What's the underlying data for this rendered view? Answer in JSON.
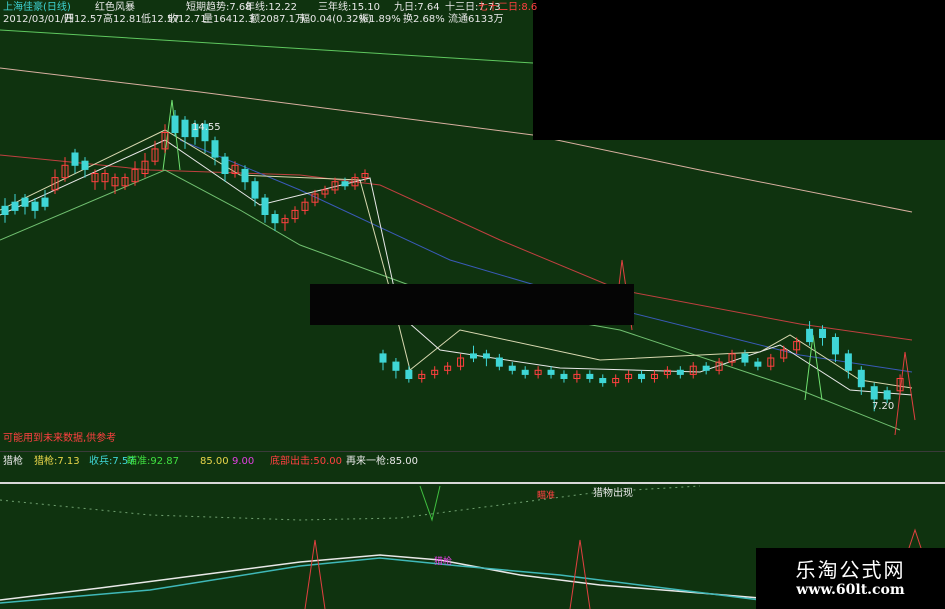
{
  "header": {
    "stock_name": "上海佳豪(日线)",
    "indicator_name": "红色风暴",
    "short_trend": "短期趋势:7.68",
    "year_line": "年线:12.22",
    "three_year_line": "三年线:15.10",
    "nine_day": "九日:7.64",
    "thirteen_day": "十三日:7.73",
    "seventy_two": "七十二日:8.6"
  },
  "ohlc_row": {
    "date": "2012/03/01/四",
    "open": "开12.57",
    "high": "高12.81",
    "low": "低12.57",
    "close": "收12.71",
    "volume": "量16412.3",
    "amount": "额2087.1万",
    "change": "幅0.04(0.32%)",
    "amplitude": "振1.89%",
    "turnover": "换2.68%",
    "float": "流通6133万"
  },
  "price_annotations": {
    "high_label": "14.55",
    "low_label": "7.20"
  },
  "disclaimer": "可能用到未来数据,供参考",
  "lower_panel": {
    "name": "猎枪",
    "hunt": "猎枪:7.13",
    "collect": "收兵:7.57",
    "aim": "瞄准:92.87",
    "value_85": "85.00",
    "value_9": "9.00",
    "bearish_out": "底部出击:50.00",
    "again": "再来一枪:85.00",
    "prey_appears": "猎物出现",
    "aim_marker": "瞄准",
    "hunt_marker": "猎枪"
  },
  "watermark": {
    "title": "乐淘公式网",
    "url": "www.60lt.com"
  },
  "chart_data": {
    "type": "candlestick",
    "main_price_range": [
      6.5,
      16.5
    ],
    "high_point": 14.55,
    "low_point": 7.2,
    "candles": [
      {
        "o": 12.0,
        "c": 12.2,
        "h": 12.4,
        "l": 11.8,
        "up": false
      },
      {
        "o": 12.1,
        "c": 12.3,
        "h": 12.5,
        "l": 12.0,
        "up": false
      },
      {
        "o": 12.2,
        "c": 12.4,
        "h": 12.5,
        "l": 12.0,
        "up": false
      },
      {
        "o": 12.3,
        "c": 12.1,
        "h": 12.4,
        "l": 11.9,
        "up": false
      },
      {
        "o": 12.2,
        "c": 12.4,
        "h": 12.6,
        "l": 12.1,
        "up": false
      },
      {
        "o": 12.6,
        "c": 12.9,
        "h": 13.1,
        "l": 12.5,
        "up": true
      },
      {
        "o": 12.9,
        "c": 13.2,
        "h": 13.4,
        "l": 12.8,
        "up": true
      },
      {
        "o": 13.2,
        "c": 13.5,
        "h": 13.6,
        "l": 13.0,
        "up": false
      },
      {
        "o": 13.3,
        "c": 13.1,
        "h": 13.4,
        "l": 12.9,
        "up": false
      },
      {
        "o": 13.0,
        "c": 12.8,
        "h": 13.1,
        "l": 12.6,
        "up": true
      },
      {
        "o": 12.8,
        "c": 13.0,
        "h": 13.1,
        "l": 12.6,
        "up": true
      },
      {
        "o": 12.9,
        "c": 12.7,
        "h": 13.0,
        "l": 12.5,
        "up": true
      },
      {
        "o": 12.7,
        "c": 12.9,
        "h": 13.0,
        "l": 12.6,
        "up": true
      },
      {
        "o": 12.8,
        "c": 13.1,
        "h": 13.3,
        "l": 12.7,
        "up": true
      },
      {
        "o": 13.0,
        "c": 13.3,
        "h": 13.5,
        "l": 12.9,
        "up": true
      },
      {
        "o": 13.3,
        "c": 13.6,
        "h": 13.8,
        "l": 13.2,
        "up": true
      },
      {
        "o": 13.6,
        "c": 14.0,
        "h": 14.2,
        "l": 13.5,
        "up": true
      },
      {
        "o": 14.0,
        "c": 14.4,
        "h": 14.55,
        "l": 13.9,
        "up": false
      },
      {
        "o": 14.3,
        "c": 13.9,
        "h": 14.4,
        "l": 13.6,
        "up": false
      },
      {
        "o": 13.9,
        "c": 14.2,
        "h": 14.3,
        "l": 13.7,
        "up": false
      },
      {
        "o": 14.2,
        "c": 13.8,
        "h": 14.3,
        "l": 13.5,
        "up": false
      },
      {
        "o": 13.8,
        "c": 13.4,
        "h": 13.9,
        "l": 13.2,
        "up": false
      },
      {
        "o": 13.4,
        "c": 13.0,
        "h": 13.5,
        "l": 12.8,
        "up": false
      },
      {
        "o": 13.0,
        "c": 13.2,
        "h": 13.3,
        "l": 12.9,
        "up": true
      },
      {
        "o": 13.1,
        "c": 12.8,
        "h": 13.2,
        "l": 12.6,
        "up": false
      },
      {
        "o": 12.8,
        "c": 12.4,
        "h": 12.9,
        "l": 12.2,
        "up": false
      },
      {
        "o": 12.4,
        "c": 12.0,
        "h": 12.5,
        "l": 11.8,
        "up": false
      },
      {
        "o": 12.0,
        "c": 11.8,
        "h": 12.1,
        "l": 11.6,
        "up": false
      },
      {
        "o": 11.8,
        "c": 11.9,
        "h": 12.0,
        "l": 11.6,
        "up": true
      },
      {
        "o": 11.9,
        "c": 12.1,
        "h": 12.2,
        "l": 11.8,
        "up": true
      },
      {
        "o": 12.1,
        "c": 12.3,
        "h": 12.4,
        "l": 12.0,
        "up": true
      },
      {
        "o": 12.3,
        "c": 12.5,
        "h": 12.6,
        "l": 12.2,
        "up": true
      },
      {
        "o": 12.5,
        "c": 12.6,
        "h": 12.7,
        "l": 12.4,
        "up": true
      },
      {
        "o": 12.6,
        "c": 12.8,
        "h": 12.9,
        "l": 12.5,
        "up": true
      },
      {
        "o": 12.8,
        "c": 12.7,
        "h": 12.9,
        "l": 12.6,
        "up": false
      },
      {
        "o": 12.7,
        "c": 12.9,
        "h": 13.0,
        "l": 12.6,
        "up": true
      },
      {
        "o": 12.9,
        "c": 13.0,
        "h": 13.1,
        "l": 12.8,
        "up": true
      },
      {
        "o": 8.6,
        "c": 8.4,
        "h": 8.7,
        "l": 8.2,
        "up": false
      },
      {
        "o": 8.4,
        "c": 8.2,
        "h": 8.5,
        "l": 8.0,
        "up": false
      },
      {
        "o": 8.2,
        "c": 8.0,
        "h": 8.3,
        "l": 7.9,
        "up": false
      },
      {
        "o": 8.0,
        "c": 8.1,
        "h": 8.2,
        "l": 7.9,
        "up": true
      },
      {
        "o": 8.1,
        "c": 8.2,
        "h": 8.3,
        "l": 8.0,
        "up": true
      },
      {
        "o": 8.2,
        "c": 8.3,
        "h": 8.4,
        "l": 8.1,
        "up": true
      },
      {
        "o": 8.3,
        "c": 8.5,
        "h": 8.6,
        "l": 8.2,
        "up": true
      },
      {
        "o": 8.5,
        "c": 8.6,
        "h": 8.8,
        "l": 8.4,
        "up": false
      },
      {
        "o": 8.6,
        "c": 8.5,
        "h": 8.7,
        "l": 8.3,
        "up": false
      },
      {
        "o": 8.5,
        "c": 8.3,
        "h": 8.6,
        "l": 8.2,
        "up": false
      },
      {
        "o": 8.3,
        "c": 8.2,
        "h": 8.4,
        "l": 8.1,
        "up": false
      },
      {
        "o": 8.2,
        "c": 8.1,
        "h": 8.3,
        "l": 8.0,
        "up": false
      },
      {
        "o": 8.1,
        "c": 8.2,
        "h": 8.3,
        "l": 8.0,
        "up": true
      },
      {
        "o": 8.2,
        "c": 8.1,
        "h": 8.3,
        "l": 8.0,
        "up": false
      },
      {
        "o": 8.1,
        "c": 8.0,
        "h": 8.2,
        "l": 7.9,
        "up": false
      },
      {
        "o": 8.0,
        "c": 8.1,
        "h": 8.2,
        "l": 7.9,
        "up": true
      },
      {
        "o": 8.1,
        "c": 8.0,
        "h": 8.2,
        "l": 7.9,
        "up": false
      },
      {
        "o": 8.0,
        "c": 7.9,
        "h": 8.1,
        "l": 7.8,
        "up": false
      },
      {
        "o": 7.9,
        "c": 8.0,
        "h": 8.1,
        "l": 7.8,
        "up": true
      },
      {
        "o": 8.0,
        "c": 8.1,
        "h": 8.2,
        "l": 7.9,
        "up": true
      },
      {
        "o": 8.1,
        "c": 8.0,
        "h": 8.2,
        "l": 7.9,
        "up": false
      },
      {
        "o": 8.0,
        "c": 8.1,
        "h": 8.2,
        "l": 7.9,
        "up": true
      },
      {
        "o": 8.1,
        "c": 8.2,
        "h": 8.3,
        "l": 8.0,
        "up": true
      },
      {
        "o": 8.2,
        "c": 8.1,
        "h": 8.3,
        "l": 8.0,
        "up": false
      },
      {
        "o": 8.1,
        "c": 8.3,
        "h": 8.4,
        "l": 8.0,
        "up": true
      },
      {
        "o": 8.3,
        "c": 8.2,
        "h": 8.4,
        "l": 8.1,
        "up": false
      },
      {
        "o": 8.2,
        "c": 8.4,
        "h": 8.5,
        "l": 8.1,
        "up": true
      },
      {
        "o": 8.4,
        "c": 8.6,
        "h": 8.7,
        "l": 8.3,
        "up": true
      },
      {
        "o": 8.6,
        "c": 8.4,
        "h": 8.7,
        "l": 8.3,
        "up": false
      },
      {
        "o": 8.4,
        "c": 8.3,
        "h": 8.5,
        "l": 8.2,
        "up": false
      },
      {
        "o": 8.3,
        "c": 8.5,
        "h": 8.6,
        "l": 8.2,
        "up": true
      },
      {
        "o": 8.5,
        "c": 8.7,
        "h": 8.8,
        "l": 8.4,
        "up": true
      },
      {
        "o": 8.7,
        "c": 8.9,
        "h": 9.0,
        "l": 8.6,
        "up": true
      },
      {
        "o": 8.9,
        "c": 9.2,
        "h": 9.4,
        "l": 8.8,
        "up": false
      },
      {
        "o": 9.2,
        "c": 9.0,
        "h": 9.3,
        "l": 8.8,
        "up": false
      },
      {
        "o": 9.0,
        "c": 8.6,
        "h": 9.1,
        "l": 8.4,
        "up": false
      },
      {
        "o": 8.6,
        "c": 8.2,
        "h": 8.7,
        "l": 8.0,
        "up": false
      },
      {
        "o": 8.2,
        "c": 7.8,
        "h": 8.3,
        "l": 7.6,
        "up": false
      },
      {
        "o": 7.8,
        "c": 7.5,
        "h": 7.9,
        "l": 7.2,
        "up": false
      },
      {
        "o": 7.5,
        "c": 7.7,
        "h": 7.8,
        "l": 7.4,
        "up": false
      },
      {
        "o": 7.7,
        "c": 8.0,
        "h": 8.1,
        "l": 7.6,
        "up": true
      }
    ]
  }
}
